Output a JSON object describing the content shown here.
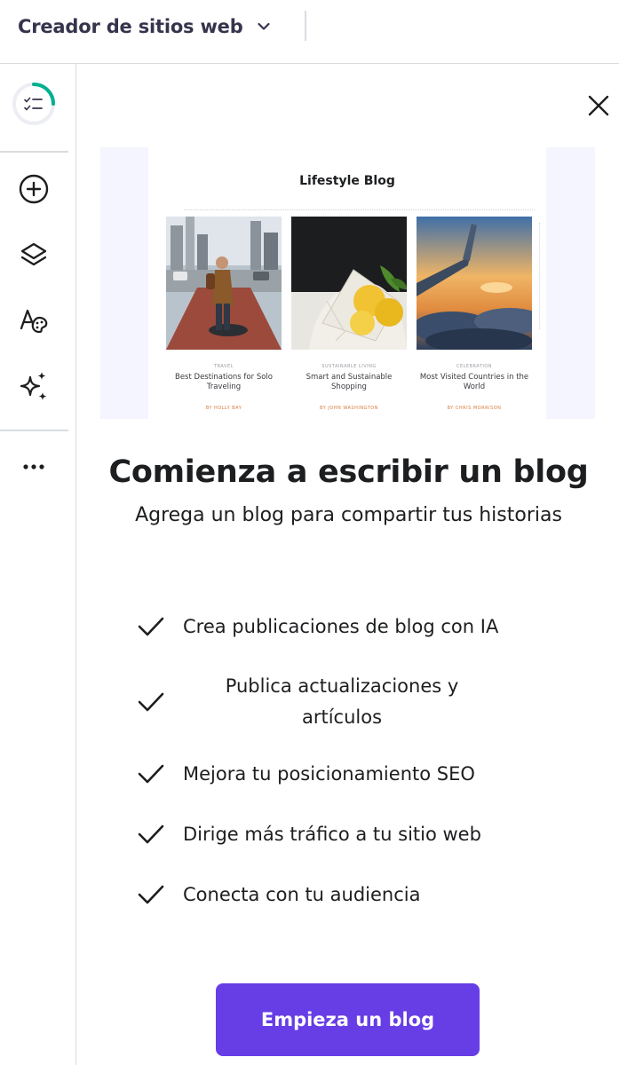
{
  "header": {
    "app_title": "Creador de sitios web",
    "switch_icon": "chevron-down-icon"
  },
  "sidebar": {
    "items": [
      {
        "name": "checklist-progress",
        "icon": "checklist-icon",
        "progress_percent": 25
      },
      {
        "name": "add-element",
        "icon": "plus-circle-icon"
      },
      {
        "name": "layers",
        "icon": "layers-icon"
      },
      {
        "name": "styles",
        "icon": "palette-text-icon"
      },
      {
        "name": "ai-tools",
        "icon": "sparkles-icon"
      },
      {
        "name": "more",
        "icon": "more-horizontal-icon"
      }
    ]
  },
  "panel": {
    "close_icon": "close-icon",
    "preview": {
      "title": "Lifestyle Blog",
      "posts": [
        {
          "category": "TRAVEL",
          "title": "Best Destinations for Solo Traveling",
          "author": "BY HOLLY BAY"
        },
        {
          "category": "SUSTAINABLE LIVING",
          "title": "Smart and Sustainable Shopping",
          "author": "BY JOHN WASHINGTON"
        },
        {
          "category": "CELEBRATION",
          "title": "Most Visited Countries in the World",
          "author": "BY CHRIS MORRISON"
        }
      ]
    },
    "heading": "Comienza a escribir un blog",
    "subheading": "Agrega un blog para compartir tus historias",
    "features": [
      {
        "text": "Crea publicaciones de blog con IA"
      },
      {
        "text": "Publica actualizaciones y artículos"
      },
      {
        "text": "Mejora tu posicionamiento SEO"
      },
      {
        "text": "Dirige más tráfico a tu sitio web"
      },
      {
        "text": "Conecta con tu audiencia"
      }
    ],
    "cta_label": "Empieza un blog"
  },
  "colors": {
    "accent": "#673de6",
    "progress": "#00b090",
    "text": "#1d1e20",
    "border": "#dadce0"
  }
}
